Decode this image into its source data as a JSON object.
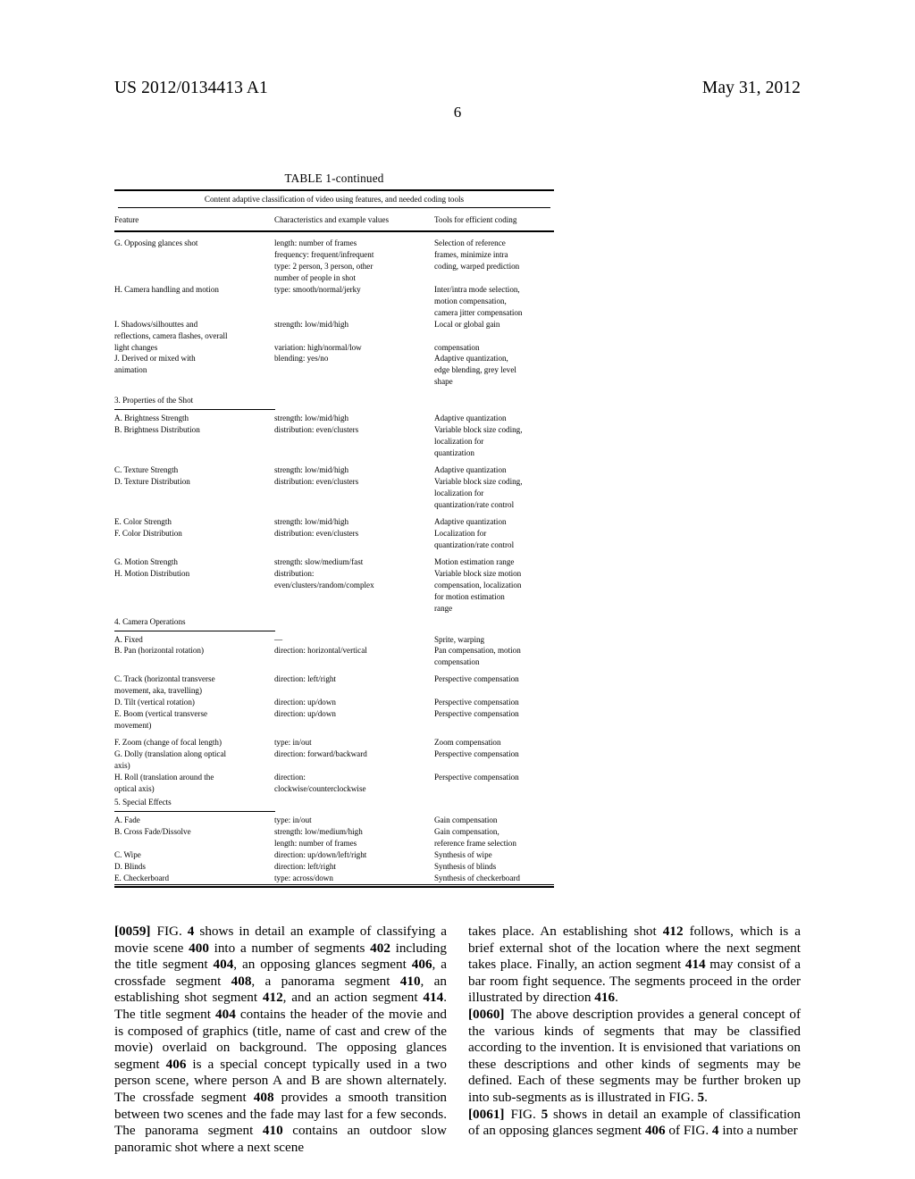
{
  "header": {
    "publication_number": "US 2012/0134413 A1",
    "publication_date": "May 31, 2012",
    "page_number": "6"
  },
  "table": {
    "title": "TABLE 1-continued",
    "subtitle": "Content adaptive classification of video using features, and needed coding tools",
    "columns": [
      "Feature",
      "Characteristics and example values",
      "Tools for efficient coding"
    ],
    "rows": [
      {
        "type": "data",
        "feature": "G. Opposing glances shot",
        "characteristics": "length: number of frames\nfrequency: frequent/infrequent\ntype: 2 person, 3 person, other\nnumber of people in shot",
        "tools": "Selection of reference\nframes, minimize intra\ncoding, warped prediction"
      },
      {
        "type": "data",
        "feature": "H. Camera handling and motion",
        "characteristics": "type: smooth/normal/jerky",
        "tools": "Inter/intra mode selection,\nmotion compensation,\ncamera jitter compensation"
      },
      {
        "type": "data",
        "feature": "I. Shadows/silhouttes and\nreflections, camera flashes, overall\nlight changes",
        "characteristics": "strength: low/mid/high\n\nvariation: high/normal/low",
        "tools": "Local or global gain\n\ncompensation"
      },
      {
        "type": "data",
        "feature": "J. Derived or mixed with\nanimation",
        "characteristics": "blending: yes/no",
        "tools": "Adaptive quantization,\nedge blending, grey level\nshape"
      },
      {
        "type": "section",
        "label": "3. Properties of the Shot"
      },
      {
        "type": "data",
        "feature": "A. Brightness Strength",
        "characteristics": "strength: low/mid/high",
        "tools": "Adaptive quantization"
      },
      {
        "type": "data",
        "feature": "B. Brightness Distribution",
        "characteristics": "distribution: even/clusters",
        "tools": "Variable block size coding,\nlocalization for\nquantization"
      },
      {
        "type": "data",
        "feature": "C. Texture Strength",
        "characteristics": "strength: low/mid/high",
        "tools": "Adaptive quantization"
      },
      {
        "type": "data",
        "feature": "D. Texture Distribution",
        "characteristics": "distribution: even/clusters",
        "tools": "Variable block size coding,\nlocalization for\nquantization/rate control"
      },
      {
        "type": "data",
        "feature": "E. Color Strength",
        "characteristics": "strength: low/mid/high",
        "tools": "Adaptive quantization"
      },
      {
        "type": "data",
        "feature": "F. Color Distribution",
        "characteristics": "distribution: even/clusters",
        "tools": "Localization for\nquantization/rate control"
      },
      {
        "type": "data",
        "feature": "G. Motion Strength",
        "characteristics": "strength: slow/medium/fast",
        "tools": "Motion estimation range"
      },
      {
        "type": "data",
        "feature": "H. Motion Distribution",
        "characteristics": "distribution:\neven/clusters/random/complex",
        "tools": "Variable block size motion\ncompensation, localization\nfor motion estimation\nrange"
      },
      {
        "type": "section",
        "label": "4. Camera Operations"
      },
      {
        "type": "data",
        "feature": "A. Fixed",
        "characteristics": "—",
        "tools": "Sprite, warping"
      },
      {
        "type": "data",
        "feature": "B. Pan (horizontal rotation)",
        "characteristics": "direction: horizontal/vertical",
        "tools": "Pan compensation, motion\ncompensation"
      },
      {
        "type": "data",
        "feature": "C. Track (horizontal transverse\nmovement, aka, travelling)",
        "characteristics": "direction: left/right",
        "tools": "Perspective compensation"
      },
      {
        "type": "data",
        "feature": "D. Tilt (vertical rotation)",
        "characteristics": "direction: up/down",
        "tools": "Perspective compensation"
      },
      {
        "type": "data",
        "feature": "E. Boom (vertical transverse\nmovement)",
        "characteristics": "direction: up/down",
        "tools": "Perspective compensation"
      },
      {
        "type": "data",
        "feature": "F. Zoom (change of focal length)",
        "characteristics": "type: in/out",
        "tools": "Zoom compensation"
      },
      {
        "type": "data",
        "feature": "G. Dolly (translation along optical\naxis)",
        "characteristics": "direction: forward/backward",
        "tools": "Perspective compensation"
      },
      {
        "type": "data",
        "feature": "H. Roll (translation around the\noptical axis)",
        "characteristics": "direction:\nclockwise/counterclockwise",
        "tools": "Perspective compensation"
      },
      {
        "type": "section",
        "label": "5. Special Effects"
      },
      {
        "type": "data",
        "feature": "A. Fade",
        "characteristics": "type: in/out",
        "tools": "Gain compensation"
      },
      {
        "type": "data",
        "feature": "B. Cross Fade/Dissolve",
        "characteristics": "strength: low/medium/high\nlength: number of frames",
        "tools": "Gain compensation,\nreference frame selection"
      },
      {
        "type": "data",
        "feature": "C. Wipe",
        "characteristics": "direction: up/down/left/right",
        "tools": "Synthesis of wipe"
      },
      {
        "type": "data",
        "feature": "D. Blinds",
        "characteristics": "direction: left/right",
        "tools": "Synthesis of blinds"
      },
      {
        "type": "data",
        "feature": "E. Checkerboard",
        "characteristics": "type: across/down",
        "tools": "Synthesis of checkerboard"
      }
    ]
  },
  "body": {
    "left_column": {
      "paragraph_0059": {
        "number": "[0059]",
        "segments": [
          {
            "text": "FIG. ",
            "bold": false
          },
          {
            "text": "4",
            "bold": true
          },
          {
            "text": " shows in detail an example of classifying a movie scene ",
            "bold": false
          },
          {
            "text": "400",
            "bold": true
          },
          {
            "text": " into a number of segments ",
            "bold": false
          },
          {
            "text": "402",
            "bold": true
          },
          {
            "text": " including the title segment ",
            "bold": false
          },
          {
            "text": "404",
            "bold": true
          },
          {
            "text": ", an opposing glances segment ",
            "bold": false
          },
          {
            "text": "406",
            "bold": true
          },
          {
            "text": ", a crossfade segment ",
            "bold": false
          },
          {
            "text": "408",
            "bold": true
          },
          {
            "text": ", a panorama segment ",
            "bold": false
          },
          {
            "text": "410",
            "bold": true
          },
          {
            "text": ", an establishing shot segment ",
            "bold": false
          },
          {
            "text": "412",
            "bold": true
          },
          {
            "text": ", and an action segment ",
            "bold": false
          },
          {
            "text": "414",
            "bold": true
          },
          {
            "text": ". The title segment ",
            "bold": false
          },
          {
            "text": "404",
            "bold": true
          },
          {
            "text": " contains the header of the movie and is composed of graphics (title, name of cast and crew of the movie) overlaid on background. The opposing glances segment ",
            "bold": false
          },
          {
            "text": "406",
            "bold": true
          },
          {
            "text": " is a special concept typically used in a two person scene, where person A and B are shown alternately. The crossfade segment ",
            "bold": false
          },
          {
            "text": "408",
            "bold": true
          },
          {
            "text": " provides a smooth transition between two scenes and the fade may last for a few seconds. The panorama segment ",
            "bold": false
          },
          {
            "text": "410",
            "bold": true
          },
          {
            "text": " contains an outdoor slow panoramic shot where a next scene",
            "bold": false
          }
        ]
      }
    },
    "right_column": {
      "paragraph_0059_cont": {
        "segments": [
          {
            "text": "takes place. An establishing shot ",
            "bold": false
          },
          {
            "text": "412",
            "bold": true
          },
          {
            "text": " follows, which is a brief external shot of the location where the next segment takes place. Finally, an action segment ",
            "bold": false
          },
          {
            "text": "414",
            "bold": true
          },
          {
            "text": " may consist of a bar room fight sequence. The segments proceed in the order illustrated by direction ",
            "bold": false
          },
          {
            "text": "416",
            "bold": true
          },
          {
            "text": ".",
            "bold": false
          }
        ]
      },
      "paragraph_0060": {
        "number": "[0060]",
        "segments": [
          {
            "text": "The above description provides a general concept of the various kinds of segments that may be classified according to the invention. It is envisioned that variations on these descriptions and other kinds of segments may be defined. Each of these segments may be further broken up into sub-segments as is illustrated in FIG. ",
            "bold": false
          },
          {
            "text": "5",
            "bold": true
          },
          {
            "text": ".",
            "bold": false
          }
        ]
      },
      "paragraph_0061": {
        "number": "[0061]",
        "segments": [
          {
            "text": "FIG. ",
            "bold": false
          },
          {
            "text": "5",
            "bold": true
          },
          {
            "text": " shows in detail an example of classification of an opposing glances segment ",
            "bold": false
          },
          {
            "text": "406",
            "bold": true
          },
          {
            "text": " of FIG. ",
            "bold": false
          },
          {
            "text": "4",
            "bold": true
          },
          {
            "text": " into a number",
            "bold": false
          }
        ]
      }
    }
  }
}
